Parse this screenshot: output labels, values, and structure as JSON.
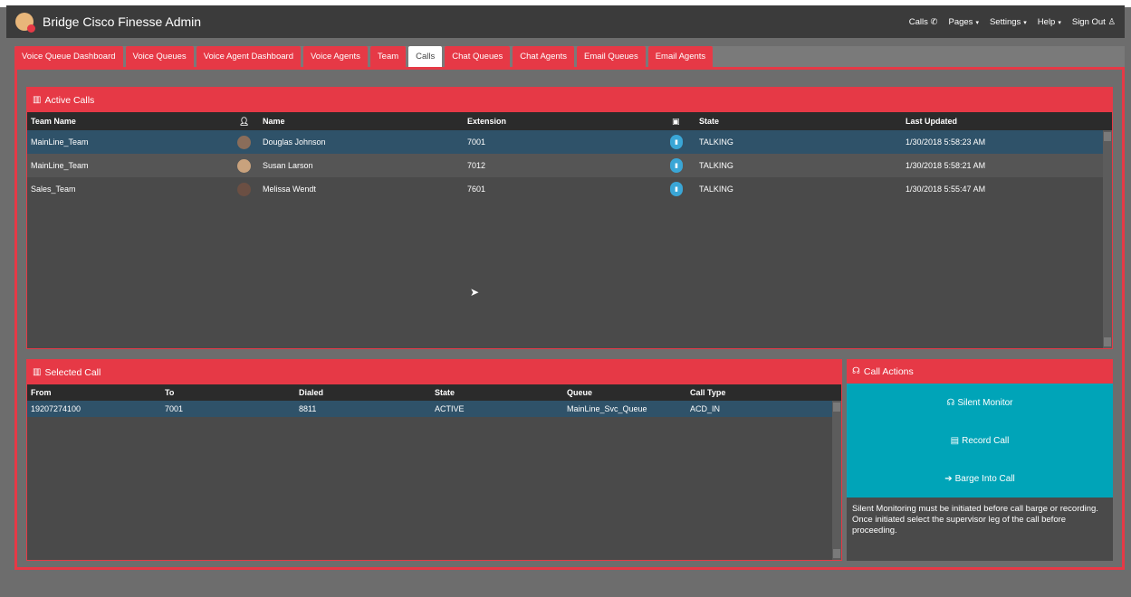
{
  "header": {
    "brand": "Bridge Cisco Finesse Admin",
    "nav": {
      "calls": "Calls",
      "calls_icon": "phone-icon",
      "pages": "Pages",
      "settings": "Settings",
      "help": "Help",
      "sign_out": "Sign Out",
      "sign_out_icon": "user-icon",
      "caret": "▾"
    }
  },
  "tabs": [
    {
      "label": "Voice Queue Dashboard"
    },
    {
      "label": "Voice Queues"
    },
    {
      "label": "Voice Agent Dashboard"
    },
    {
      "label": "Voice Agents"
    },
    {
      "label": "Team"
    },
    {
      "label": "Calls"
    },
    {
      "label": "Chat Queues"
    },
    {
      "label": "Chat Agents"
    },
    {
      "label": "Email Queues"
    },
    {
      "label": "Email Agents"
    }
  ],
  "active_tab": "Calls",
  "active_calls": {
    "title": "Active Calls",
    "columns": {
      "team_name": "Team Name",
      "name": "Name",
      "extension": "Extension",
      "state": "State",
      "last_updated": "Last Updated"
    },
    "rows": [
      {
        "team": "MainLine_Team",
        "name": "Douglas Johnson",
        "extension": "7001",
        "state": "TALKING",
        "last_updated": "1/30/2018 5:58:23 AM"
      },
      {
        "team": "MainLine_Team",
        "name": "Susan Larson",
        "extension": "7012",
        "state": "TALKING",
        "last_updated": "1/30/2018 5:58:21 AM"
      },
      {
        "team": "Sales_Team",
        "name": "Melissa Wendt",
        "extension": "7601",
        "state": "TALKING",
        "last_updated": "1/30/2018 5:55:47 AM"
      }
    ]
  },
  "selected_call": {
    "title": "Selected Call",
    "columns": {
      "from": "From",
      "to": "To",
      "dialed": "Dialed",
      "state": "State",
      "queue": "Queue",
      "call_type": "Call Type"
    },
    "rows": [
      {
        "from": "19207274100",
        "to": "7001",
        "dialed": "8811",
        "state": "ACTIVE",
        "queue": "MainLine_Svc_Queue",
        "call_type": "ACD_IN"
      }
    ]
  },
  "call_actions": {
    "title": "Call Actions",
    "silent_monitor": "Silent Monitor",
    "record_call": "Record Call",
    "barge_into_call": "Barge Into Call",
    "note": "Silent Monitoring must be initiated before call barge or recording. Once initiated select the supervisor leg of the call before proceeding."
  },
  "colors": {
    "accent": "#e63946",
    "navbar": "#3b3b3b",
    "action_button": "#00a4b8",
    "selected_row": "#2f5269",
    "status": "#3aa6d6"
  }
}
